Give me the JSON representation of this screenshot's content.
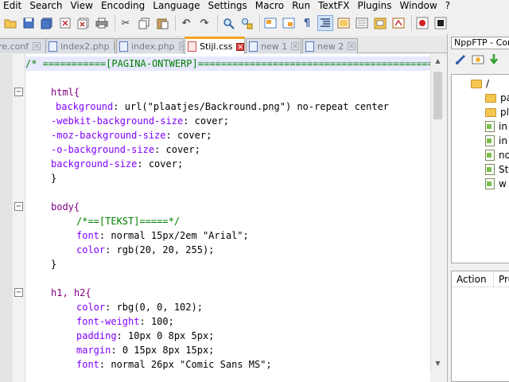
{
  "menu": [
    "Edit",
    "Search",
    "View",
    "Encoding",
    "Language",
    "Settings",
    "Macro",
    "Run",
    "TextFX",
    "Plugins",
    "Window",
    "?"
  ],
  "toolbar": {
    "icons": [
      "open-file",
      "save",
      "save-all",
      "close",
      "close-all",
      "print",
      "cut",
      "copy",
      "paste",
      "undo",
      "redo",
      "find",
      "replace",
      "zoom-in",
      "zoom-out",
      "sync-vertical",
      "sync-horizontal",
      "word-wrap",
      "show-all-chars",
      "indent-guide",
      "doc-map",
      "function-list",
      "folder-workspace",
      "monitor",
      "record-macro",
      "stop-record"
    ]
  },
  "tabs": [
    {
      "label": "re.conf",
      "active": false
    },
    {
      "label": "index2.php",
      "active": false
    },
    {
      "label": "index.php",
      "active": false
    },
    {
      "label": "Stijl.css",
      "active": true
    },
    {
      "label": "new  1",
      "active": false
    },
    {
      "label": "new  2",
      "active": false
    }
  ],
  "editor": {
    "lines": [
      {
        "type": "comment",
        "text": "/* ===========[PAGINA-ONTWERP]=================================================="
      },
      {
        "type": "blank"
      },
      {
        "type": "selector",
        "text": "html{"
      },
      {
        "type": "prop",
        "prop": "background",
        "value": "url(\"plaatjes/Backround.png\") no-repeat center"
      },
      {
        "type": "prop",
        "prop": "-webkit-background-size",
        "value": "cover;"
      },
      {
        "type": "prop",
        "prop": "-moz-background-size",
        "value": "cover;"
      },
      {
        "type": "prop",
        "prop": "-o-background-size",
        "value": "cover;"
      },
      {
        "type": "prop",
        "prop": "background-size",
        "value": "cover;"
      },
      {
        "type": "brace",
        "text": "}"
      },
      {
        "type": "blank"
      },
      {
        "type": "selector",
        "text": "body{"
      },
      {
        "type": "comment",
        "text": "/*==[TEKST]=====*/"
      },
      {
        "type": "prop",
        "prop": "font",
        "value": "normal 15px/2em \"Arial\";"
      },
      {
        "type": "prop",
        "prop": "color",
        "value": "rgb(20, 20, 255);"
      },
      {
        "type": "brace",
        "text": "}"
      },
      {
        "type": "blank"
      },
      {
        "type": "selector",
        "text": "h1, h2{"
      },
      {
        "type": "prop",
        "prop": "color",
        "value": "rbg(0, 0, 102);"
      },
      {
        "type": "prop",
        "prop": "font-weight",
        "value": "100;"
      },
      {
        "type": "prop",
        "prop": "padding",
        "value": "10px 0 8px 5px;"
      },
      {
        "type": "prop",
        "prop": "margin",
        "value": "0 15px 8px 15px;"
      },
      {
        "type": "prop",
        "prop": "font",
        "value": "normal 26px \"Comic Sans MS\";"
      }
    ]
  },
  "panel": {
    "title": "NppFTP - Conn",
    "tree": [
      {
        "kind": "folder",
        "label": "/"
      },
      {
        "kind": "folder",
        "label": "pa"
      },
      {
        "kind": "folder",
        "label": "pl"
      },
      {
        "kind": "file",
        "label": "in"
      },
      {
        "kind": "file",
        "label": "in"
      },
      {
        "kind": "file",
        "label": "no"
      },
      {
        "kind": "file",
        "label": "St"
      },
      {
        "kind": "file",
        "label": "w"
      }
    ],
    "queue_columns": [
      "Action",
      "Pro"
    ]
  }
}
